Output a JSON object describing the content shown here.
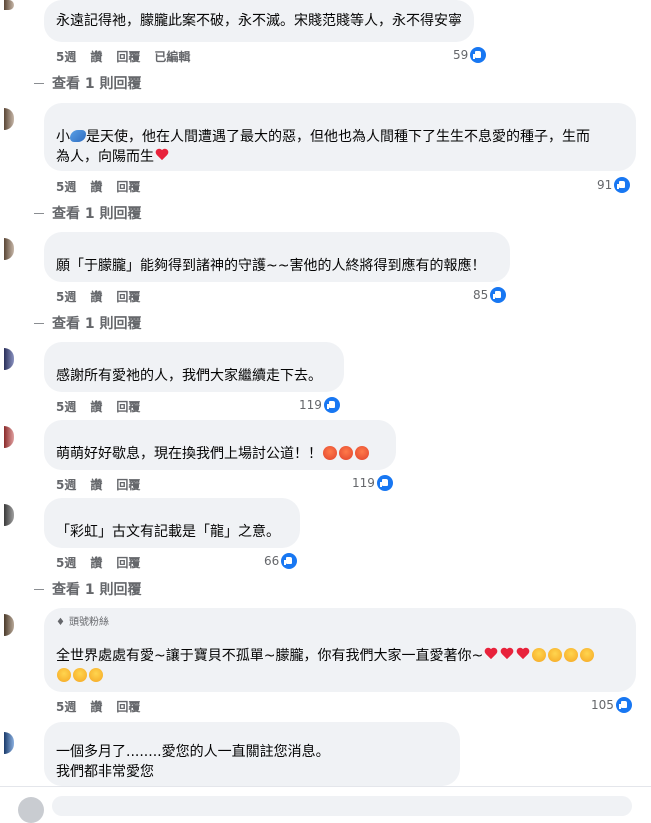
{
  "labels": {
    "like": "讚",
    "reply": "回覆",
    "edited": "已編輯",
    "view_replies": "查看 1 則回覆",
    "fan_badge": "頭號粉絲"
  },
  "comments": [
    {
      "text": "永遠記得祂，朦朧此案不破，永不滅。宋賤范賤等人，永不得安寧",
      "time": "5週",
      "reactions": "59",
      "edited": true,
      "replies": true
    },
    {
      "text1_pre": "小",
      "text1_post": "是天使，他在人間遭遇了最大的惡，但他也為人間種下了生生不息愛的種子，生而",
      "text2": "為人，向陽而生",
      "time": "5週",
      "reactions": "91",
      "replies": true
    },
    {
      "text": "願「于朦朧」能夠得到諸神的守護~~害他的人終將得到應有的報應！",
      "time": "5週",
      "reactions": "85",
      "replies": true
    },
    {
      "text": "感謝所有愛祂的人，我們大家繼續走下去。",
      "time": "5週",
      "reactions": "119"
    },
    {
      "text": "萌萌好好歇息，現在換我們上場討公道！！",
      "time": "5週",
      "reactions": "119"
    },
    {
      "text": "「彩虹」古文有記載是「龍」之意。",
      "time": "5週",
      "reactions": "66",
      "replies": true
    },
    {
      "text": "全世界處處有愛~讓于寶貝不孤單~朦朧，你有我們大家一直愛著你~",
      "time": "5週",
      "reactions": "105"
    },
    {
      "text1": "一個多月了........愛您的人一直關註您消息。",
      "text2": "我們都非常愛您"
    }
  ],
  "colors": {
    "bubble": "#f0f2f5",
    "like_blue": "#1877f2",
    "meta_gray": "#65676b"
  },
  "icons": [
    "like-icon",
    "heart-emoji",
    "angry-emoji",
    "crying-emoji",
    "dolphin-emoji",
    "gem-icon"
  ]
}
